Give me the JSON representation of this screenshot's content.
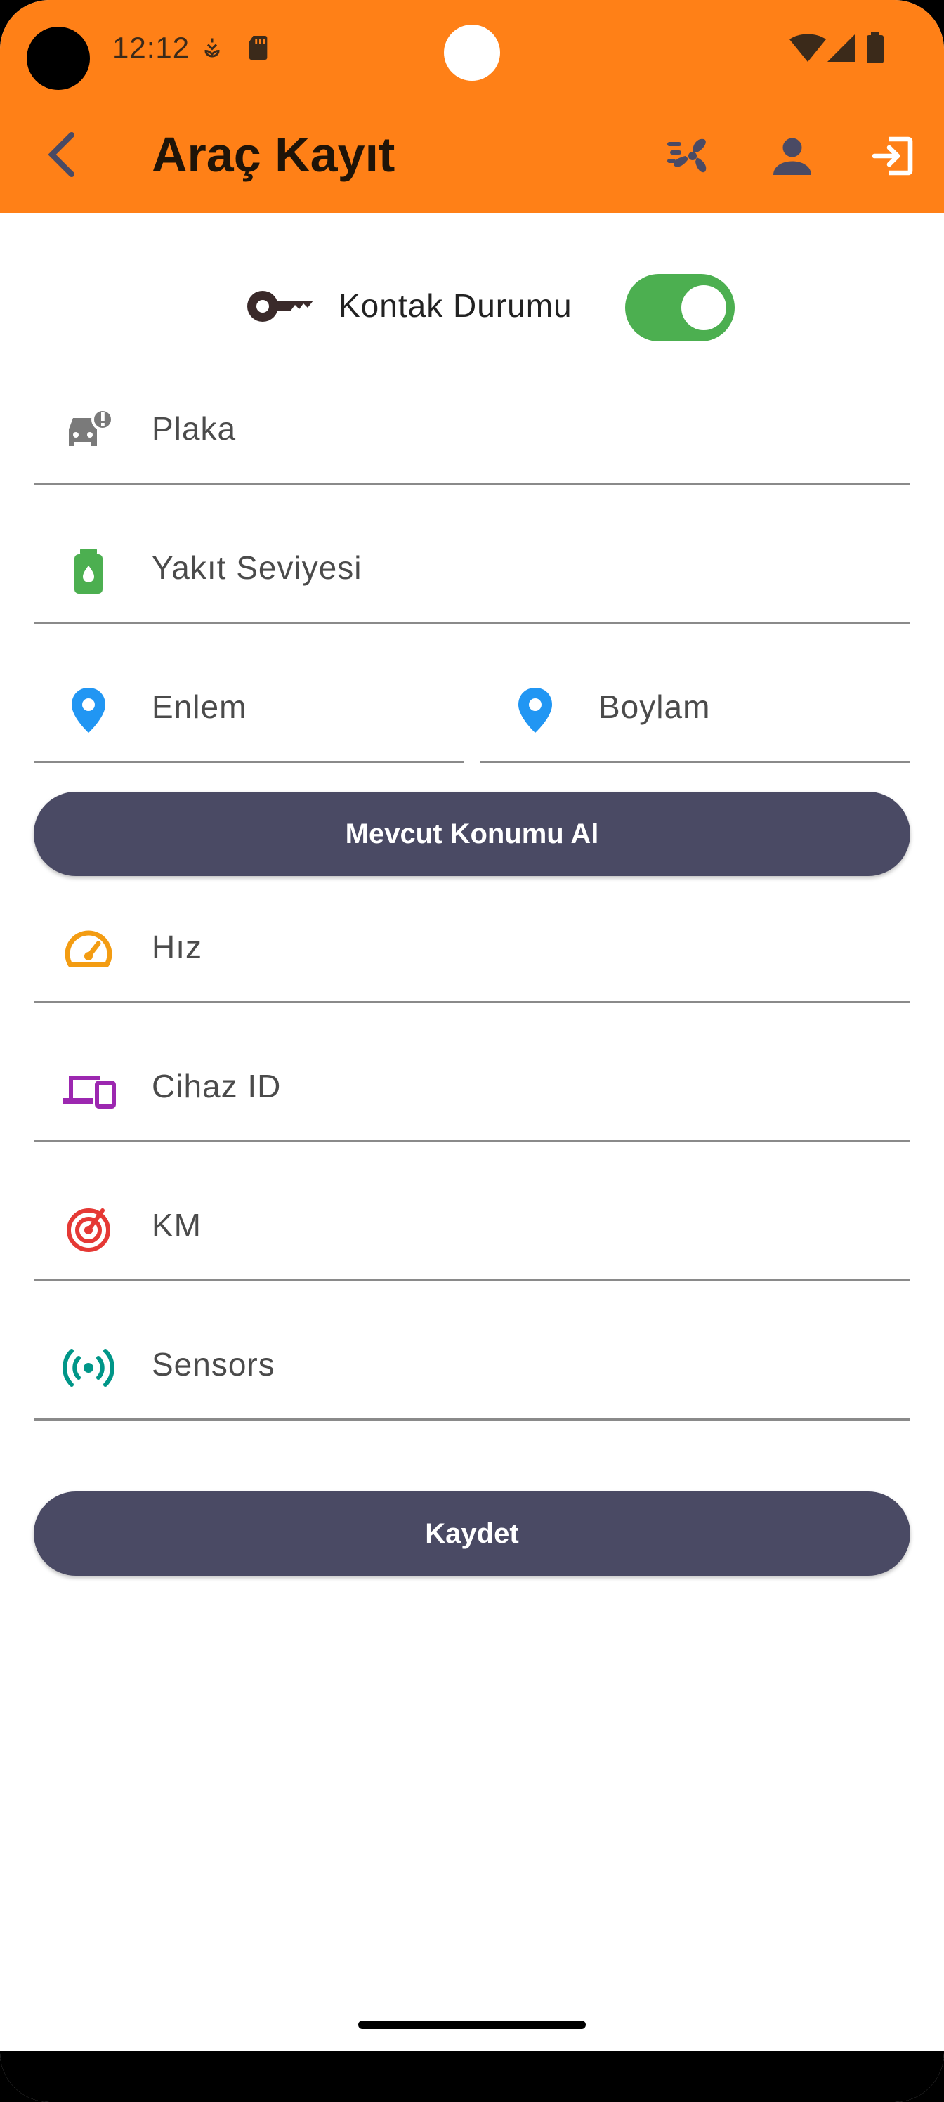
{
  "status_bar": {
    "time": "12:12"
  },
  "app_bar": {
    "title": "Araç Kayıt"
  },
  "ignition": {
    "label": "Kontak Durumu",
    "on": true
  },
  "fields": {
    "plate": "Plaka",
    "fuel": "Yakıt Seviyesi",
    "latitude": "Enlem",
    "longitude": "Boylam",
    "speed": "Hız",
    "device_id": "Cihaz ID",
    "km": "KM",
    "sensors": "Sensors"
  },
  "buttons": {
    "get_location": "Mevcut Konumu Al",
    "save": "Kaydet"
  },
  "colors": {
    "app_bar": "#FF8017",
    "button": "#4A4A64",
    "switch_on": "#4CAF50",
    "location_icon": "#2196F3",
    "fuel_icon": "#4CAF50",
    "speed_icon": "#F39C12",
    "device_icon": "#9C27B0",
    "km_icon": "#E53935",
    "sensors_icon": "#009688"
  },
  "icons": {
    "back": "chevron-left-icon",
    "fan": "fan-icon",
    "account": "person-icon",
    "logout": "logout-icon",
    "key": "key-icon",
    "plate": "car-alert-icon",
    "fuel": "fuel-icon",
    "location": "location-pin-icon",
    "speed": "speedometer-icon",
    "device": "devices-icon",
    "km": "radar-icon",
    "sensors": "sensors-icon"
  }
}
